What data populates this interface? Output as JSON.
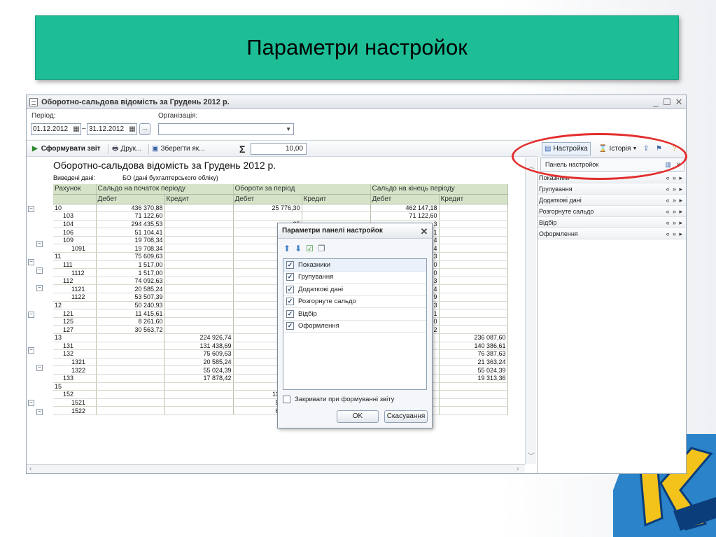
{
  "slide": {
    "title": "Параметри настройок"
  },
  "window": {
    "title": "Оборотно-сальдова відомість за Грудень 2012 р.",
    "controls": {
      "minimize": "_",
      "maximize": "☐",
      "close": "✕"
    }
  },
  "filters": {
    "period_label": "Період:",
    "org_label": "Організація:",
    "date_from": "01.12.2012",
    "date_sep": "–",
    "date_to": "31.12.2012",
    "ellipsis": "...",
    "org_value": ""
  },
  "toolbar": {
    "generate": "Сформувати звіт",
    "print": "Друк...",
    "save": "Зберегти як...",
    "sum_symbol": "Σ",
    "sum_value": "10,00"
  },
  "report": {
    "title": "Оборотно-сальдова відомість за Грудень 2012 р.",
    "data_label": "Виведені дані:",
    "data_value": "БО (дані бухгалтерського обліку)",
    "header_top": [
      "Рахунок",
      "Сальдо на початок періоду",
      "Обороти за період",
      "Сальдо на кінець періоду"
    ],
    "header_sub": [
      "Дебет",
      "Кредит",
      "Дебет",
      "Кредит",
      "Дебет",
      "Кредит"
    ],
    "rows": [
      [
        "10",
        "436 370,88",
        "",
        "25 776,30",
        "",
        "462 147,18",
        ""
      ],
      [
        "103",
        "71 122,60",
        "",
        "",
        "",
        "71 122,60",
        ""
      ],
      [
        "104",
        "294 435,53",
        "",
        "25",
        "",
        "3",
        ""
      ],
      [
        "106",
        "51 104,41",
        "",
        "",
        "",
        "1",
        ""
      ],
      [
        "109",
        "19 708,34",
        "",
        "",
        "",
        "4",
        ""
      ],
      [
        "1091",
        "19 708,34",
        "",
        "",
        "",
        "4",
        ""
      ],
      [
        "11",
        "75 609,63",
        "",
        "",
        "",
        "3",
        ""
      ],
      [
        "111",
        "1 517,00",
        "",
        "",
        "",
        "0",
        ""
      ],
      [
        "1112",
        "1 517,00",
        "",
        "",
        "",
        "0",
        ""
      ],
      [
        "112",
        "74 092,63",
        "",
        "",
        "",
        "3",
        ""
      ],
      [
        "1121",
        "20 585,24",
        "",
        "",
        "",
        "4",
        ""
      ],
      [
        "1122",
        "53 507,39",
        "",
        "",
        "",
        "9",
        ""
      ],
      [
        "12",
        "50 240,93",
        "",
        "",
        "",
        "3",
        ""
      ],
      [
        "121",
        "11 415,61",
        "",
        "",
        "",
        "1",
        ""
      ],
      [
        "125",
        "8 261,60",
        "",
        "",
        "",
        "0",
        ""
      ],
      [
        "127",
        "30 563,72",
        "",
        "",
        "",
        "2",
        ""
      ],
      [
        "13",
        "",
        "224 926,74",
        "",
        "",
        "",
        "236 087,60"
      ],
      [
        "131",
        "",
        "131 438,69",
        "",
        "",
        "",
        "140 386,61"
      ],
      [
        "132",
        "",
        "75 609,63",
        "",
        "",
        "",
        "76 387,63"
      ],
      [
        "1321",
        "",
        "20 585,24",
        "",
        "",
        "",
        "21 363,24"
      ],
      [
        "1322",
        "",
        "55 024,39",
        "",
        "",
        "",
        "55 024,39"
      ],
      [
        "133",
        "",
        "17 878,42",
        "",
        "",
        "",
        "19 313,36"
      ],
      [
        "15",
        "",
        "",
        "12",
        "12",
        "",
        ""
      ],
      [
        "152",
        "",
        "",
        "11 716,50",
        "11 716,50",
        "",
        ""
      ],
      [
        "1521",
        "",
        "",
        "5 635,34",
        "5 635,34",
        "",
        ""
      ],
      [
        "1522",
        "",
        "",
        "6 081,16",
        "6 081,16",
        "",
        ""
      ]
    ]
  },
  "side": {
    "settings_btn": "Настройка",
    "history_btn": "Історія",
    "panel_title": "Панель настройок",
    "rows": [
      "Показники",
      "Групування",
      "Додаткові дані",
      "Розгорнуте сальдо",
      "Відбір",
      "Оформлення"
    ],
    "row_arrows": "« » ▸"
  },
  "dialog": {
    "title": "Параметри панелі настройок",
    "close": "✕",
    "items": [
      "Показники",
      "Групування",
      "Додаткові дані",
      "Розгорнуте сальдо",
      "Відбір",
      "Оформлення"
    ],
    "checkmark": "✓",
    "close_on_generate": "Закривати при формуванні звіту",
    "ok": "OK",
    "cancel": "Скасування"
  },
  "colors": {
    "title_bar": "#1dbd96",
    "grid_header": "#d6e3c8",
    "highlight_oval": "#e32e2e"
  }
}
